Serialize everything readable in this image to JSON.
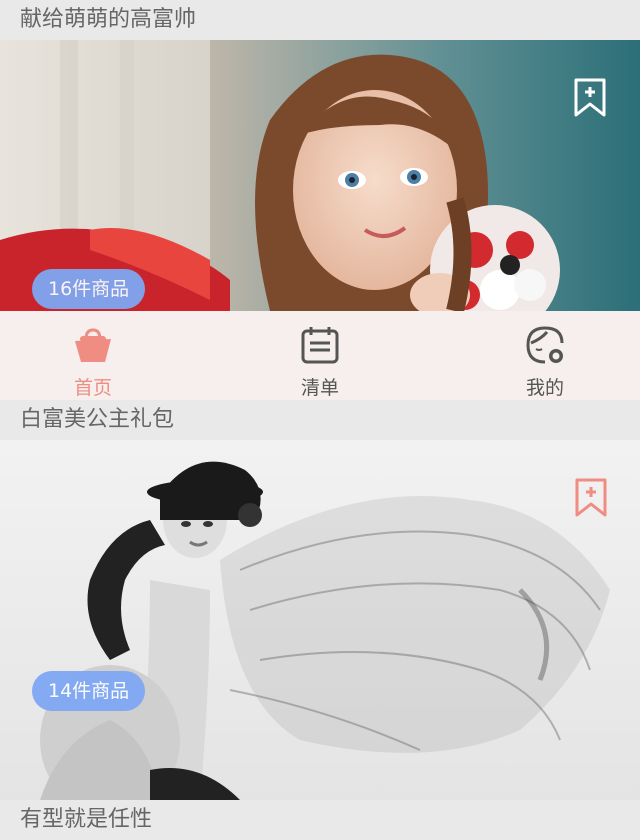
{
  "sections": [
    {
      "title": "献给萌萌的高富帅",
      "badge": "16件商品",
      "bookmark_color": "#ffffff"
    },
    {
      "title": "白富美公主礼包",
      "badge": "14件商品",
      "bookmark_color": "#ef8d83"
    },
    {
      "title": "有型就是任性"
    }
  ],
  "tabbar": {
    "tabs": [
      {
        "label": "首页",
        "icon": "basket-icon",
        "active": true
      },
      {
        "label": "清单",
        "icon": "calendar-list-icon",
        "active": false
      },
      {
        "label": "我的",
        "icon": "face-profile-icon",
        "active": false
      }
    ],
    "active_color": "#ef8d83",
    "inactive_color": "#555555",
    "background": "#f6efee"
  },
  "colors": {
    "badge": "#7ea7f3",
    "title_bar": "#e9e9e9"
  }
}
